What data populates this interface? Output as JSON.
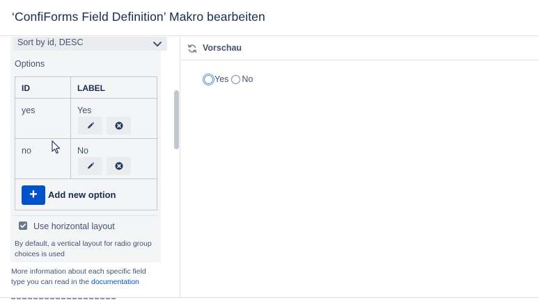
{
  "dialog": {
    "title": "‘ConfiForms Field Definition’ Makro bearbeiten"
  },
  "left": {
    "sort_value": "Sort by id, DESC",
    "options_label": "Options",
    "table": {
      "headers": {
        "id": "ID",
        "label": "LABEL"
      },
      "rows": [
        {
          "id": "yes",
          "label": "Yes"
        },
        {
          "id": "no",
          "label": "No"
        }
      ],
      "add_label": "Add new option",
      "add_icon": "+"
    },
    "horizontal_layout": {
      "checked": true,
      "label": "Use horizontal layout",
      "hint": "By default, a vertical layout for radio group choices is used"
    },
    "more_info": {
      "text": "More information about each specific field type you can read in the ",
      "link": "documentation"
    }
  },
  "preview": {
    "title": "Vorschau",
    "radios": [
      {
        "label": "Yes",
        "focused": true
      },
      {
        "label": "No",
        "focused": false
      }
    ]
  },
  "icons": {
    "chevron": "chevron-down-icon",
    "edit": "pencil-icon",
    "delete": "close-circle-icon",
    "refresh": "refresh-icon",
    "checkbox": "check-icon",
    "cursor": "mouse-pointer-icon"
  },
  "colors": {
    "primary": "#0052cc",
    "text": "#172b4d",
    "subtle_text": "#42526e",
    "panel_bg": "#f4f5f7",
    "border": "#c1c7d0",
    "focus": "#4c9aff"
  }
}
